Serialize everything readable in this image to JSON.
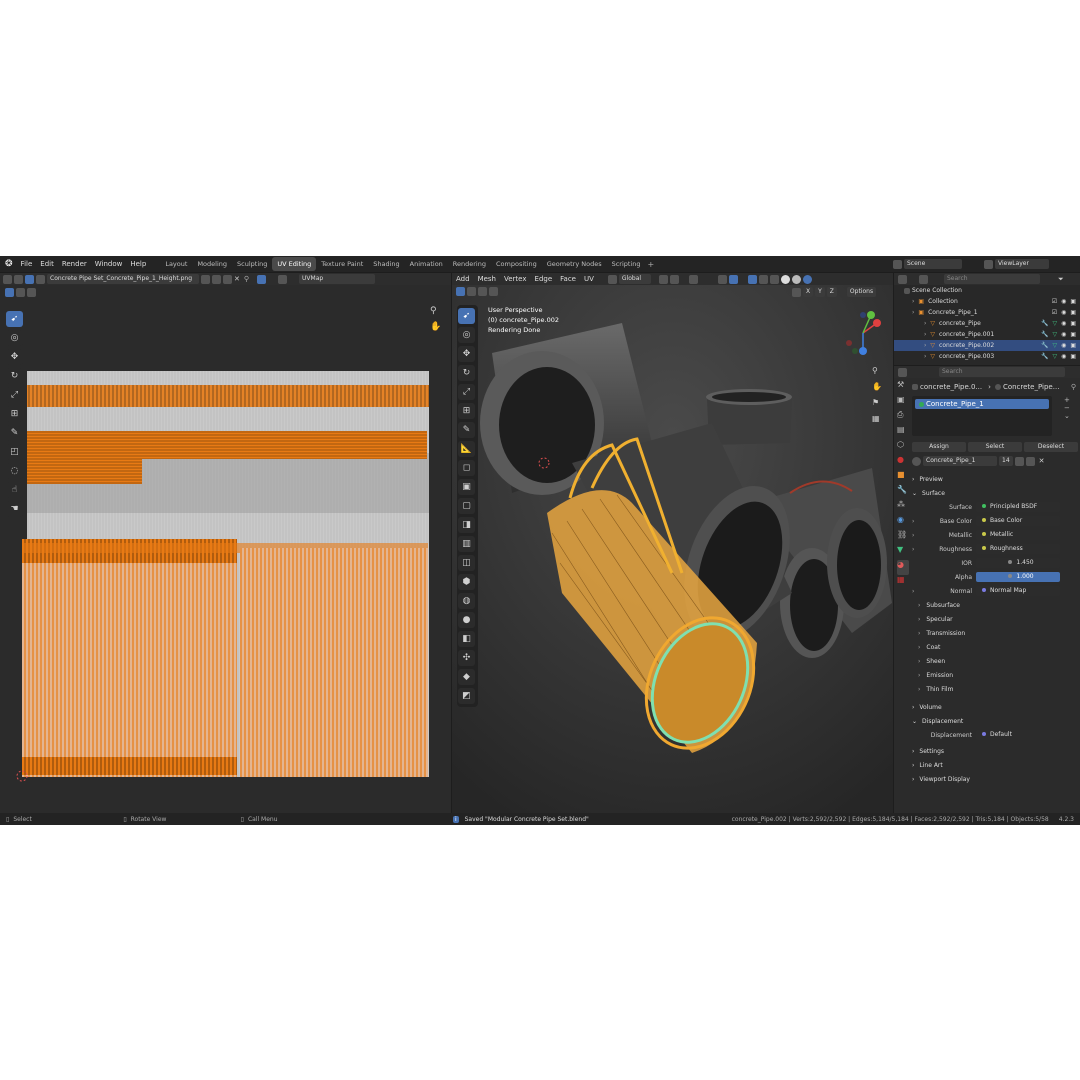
{
  "menu": [
    "File",
    "Edit",
    "Render",
    "Window",
    "Help"
  ],
  "workspaces": [
    {
      "label": "Layout",
      "active": false
    },
    {
      "label": "Modeling",
      "active": false
    },
    {
      "label": "Sculpting",
      "active": false
    },
    {
      "label": "UV Editing",
      "active": true
    },
    {
      "label": "Texture Paint",
      "active": false
    },
    {
      "label": "Shading",
      "active": false
    },
    {
      "label": "Animation",
      "active": false
    },
    {
      "label": "Rendering",
      "active": false
    },
    {
      "label": "Compositing",
      "active": false
    },
    {
      "label": "Geometry Nodes",
      "active": false
    },
    {
      "label": "Scripting",
      "active": false
    }
  ],
  "scene": {
    "label": "Scene",
    "viewlayer": "ViewLayer"
  },
  "uv_editor": {
    "image_name": "Concrete Pipe Set_Concrete_Pipe_1_Height.png",
    "uvmap": "UVMap"
  },
  "viewport": {
    "menus": [
      "Add",
      "Mesh",
      "Vertex",
      "Edge",
      "Face",
      "UV"
    ],
    "orientation": "Global",
    "axes": [
      "X",
      "Y",
      "Z"
    ],
    "options": "Options",
    "info_lines": [
      "User Perspective",
      "(0) concrete_Pipe.002",
      "Rendering Done"
    ]
  },
  "outliner": {
    "search_placeholder": "Search",
    "scene_collection": "Scene Collection",
    "rows": [
      {
        "label": "Collection",
        "indent": 1,
        "selected": false
      },
      {
        "label": "Concrete_Pipe_1",
        "indent": 1,
        "selected": false
      },
      {
        "label": "concrete_Pipe",
        "indent": 2,
        "selected": false
      },
      {
        "label": "concrete_Pipe.001",
        "indent": 2,
        "selected": false
      },
      {
        "label": "concrete_Pipe.002",
        "indent": 2,
        "selected": true
      },
      {
        "label": "concrete_Pipe.003",
        "indent": 2,
        "selected": false
      }
    ]
  },
  "properties": {
    "search_placeholder": "Search",
    "breadcrumb": [
      "concrete_Pipe.0...",
      "Concrete_Pipe..."
    ],
    "slot": "Concrete_Pipe_1",
    "slot_buttons": [
      "Assign",
      "Select",
      "Deselect"
    ],
    "material_name": "Concrete_Pipe_1",
    "material_users": "14",
    "sections_top": [
      "Preview",
      "Surface"
    ],
    "surface": {
      "label": "Surface",
      "value": "Principled BSDF"
    },
    "inputs": [
      {
        "label": "Base Color",
        "value": "Base Color",
        "type": "link"
      },
      {
        "label": "Metallic",
        "value": "Metallic",
        "type": "link"
      },
      {
        "label": "Roughness",
        "value": "Roughness",
        "type": "link"
      },
      {
        "label": "IOR",
        "value": "1.450",
        "type": "num"
      },
      {
        "label": "Alpha",
        "value": "1.000",
        "type": "slider"
      },
      {
        "label": "Normal",
        "value": "Normal Map",
        "type": "link"
      }
    ],
    "subsections": [
      "Subsurface",
      "Specular",
      "Transmission",
      "Coat",
      "Sheen",
      "Emission",
      "Thin Film"
    ],
    "volume": "Volume",
    "displacement_section": "Displacement",
    "displacement": {
      "label": "Displacement",
      "value": "Default"
    },
    "more_sections": [
      "Settings",
      "Line Art",
      "Viewport Display"
    ]
  },
  "status": {
    "select": "Select",
    "rotate": "Rotate View",
    "call_menu": "Call Menu",
    "saved": "Saved \"Modular Concrete Pipe Set.blend\"",
    "stats": "concrete_Pipe.002 | Verts:2,592/2,592 | Edges:5,184/5,184 | Faces:2,592/2,592 | Tris:5,184 | Objects:5/58",
    "version": "4.2.3"
  },
  "colors": {
    "accent": "#4772b3",
    "uv_orange": "#e87a14",
    "select_yellow": "#f0a830",
    "active_teal": "#7fe0b0"
  }
}
